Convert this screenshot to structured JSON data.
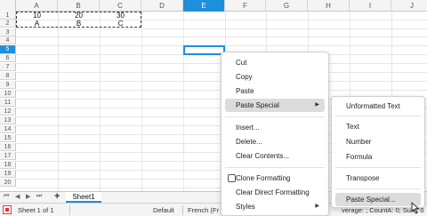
{
  "spreadsheet": {
    "columns": [
      "A",
      "B",
      "C",
      "D",
      "E",
      "F",
      "G",
      "H",
      "I",
      "J"
    ],
    "active_column": "E",
    "rows": [
      "1",
      "2",
      "3",
      "4",
      "5",
      "6",
      "7",
      "8",
      "9",
      "10",
      "11",
      "12",
      "13",
      "14",
      "15",
      "16",
      "17",
      "18",
      "19",
      "20"
    ],
    "active_row": "5",
    "cells": {
      "A1": "10",
      "B1": "20",
      "C1": "30",
      "A2": "A",
      "B2": "B",
      "C2": "C"
    },
    "colors": {
      "accent": "#1e8fdc",
      "header_bg": "#f4f4f4",
      "grid": "#e6e6e6"
    }
  },
  "tabbar": {
    "nav_first": "⏮",
    "nav_prev": "◀",
    "nav_next": "▶",
    "nav_last": "⏭",
    "add_label": "+",
    "sheet_tab": "Sheet1"
  },
  "statusbar": {
    "sheet_info": "Sheet 1 of 1",
    "page_style": "Default",
    "language": "French (Fr",
    "stats": "verage: ; CountA: 0; Sum: 0"
  },
  "context_menu": {
    "items": [
      {
        "label": "Cut"
      },
      {
        "label": "Copy"
      },
      {
        "label": "Paste"
      },
      {
        "label": "Paste Special",
        "submenu": true,
        "highlighted": true
      },
      {
        "label": "Insert..."
      },
      {
        "label": "Delete..."
      },
      {
        "label": "Clear Contents..."
      },
      {
        "label": "Clone Formatting",
        "checkbox": true
      },
      {
        "label": "Clear Direct Formatting"
      },
      {
        "label": "Styles",
        "submenu": true
      }
    ]
  },
  "paste_special_menu": {
    "items": [
      {
        "label": "Unformatted Text"
      },
      {
        "label": "Text"
      },
      {
        "label": "Number"
      },
      {
        "label": "Formula"
      },
      {
        "label": "Transpose"
      },
      {
        "label": "Paste Special...",
        "highlighted": true
      }
    ]
  }
}
